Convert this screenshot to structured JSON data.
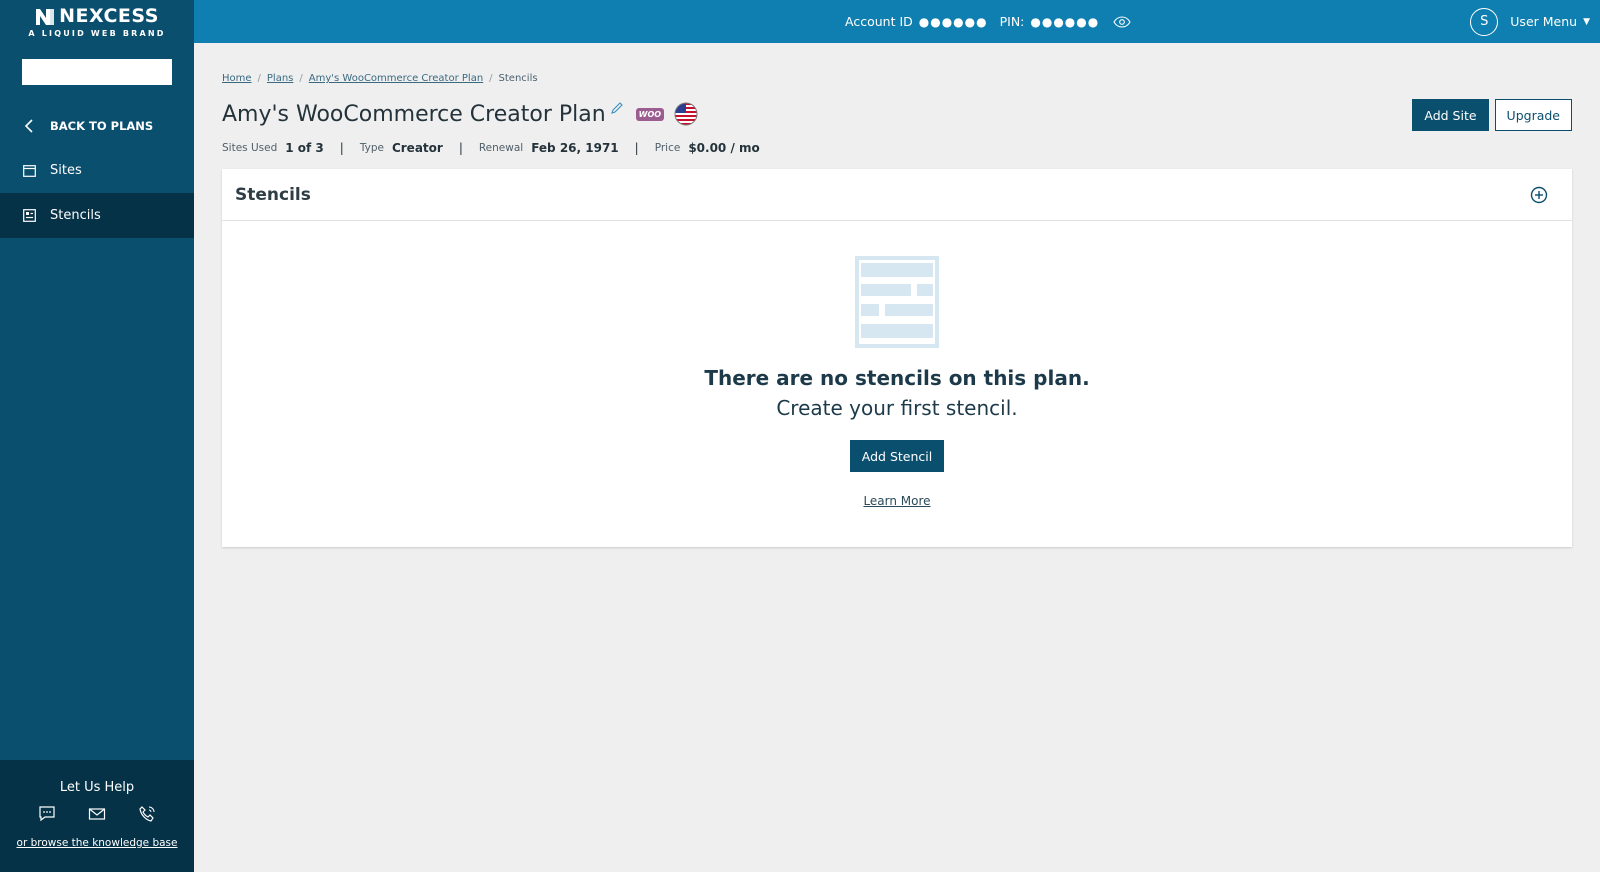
{
  "brand": {
    "name": "NEXCESS",
    "tagline": "A LIQUID WEB BRAND",
    "color": "#0b4f6f"
  },
  "topbar": {
    "account_label": "Account ID",
    "account_value": "●●●●●●",
    "pin_label": "PIN:",
    "pin_value": "●●●●●●",
    "avatar_initial": "S",
    "user_menu_label": "User Menu",
    "color": "#0e7fb0"
  },
  "sidebar": {
    "search": {
      "value": "",
      "placeholder": ""
    },
    "items": [
      {
        "label": "BACK TO PLANS",
        "icon": "chevron-left-icon"
      },
      {
        "label": "Sites",
        "icon": "browser-window-icon"
      },
      {
        "label": "Stencils",
        "icon": "stencil-icon",
        "active": true
      }
    ],
    "help": {
      "title": "Let Us Help",
      "icons": [
        "chat-icon",
        "mail-icon",
        "phone-icon"
      ],
      "link": "or browse the knowledge base"
    }
  },
  "breadcrumb": [
    "Home",
    "Plans",
    "Amy's WooCommerce Creator Plan",
    "Stencils"
  ],
  "plan": {
    "title": "Amy's WooCommerce Creator Plan",
    "woo_badge": "WOO",
    "add_site_label": "Add Site",
    "upgrade_label": "Upgrade",
    "meta": {
      "sites_used_label": "Sites Used",
      "sites_used_value": "1 of 3",
      "type_label": "Type",
      "type_value": "Creator",
      "renewal_label": "Renewal",
      "renewal_value": "Feb 26, 1971",
      "price_label": "Price",
      "price_value": "$0.00 / mo"
    }
  },
  "stencils": {
    "card_title": "Stencils",
    "empty_heading": "There are no stencils on this plan.",
    "empty_subheading": "Create your first stencil.",
    "add_label": "Add Stencil",
    "learn_more_label": "Learn More"
  }
}
